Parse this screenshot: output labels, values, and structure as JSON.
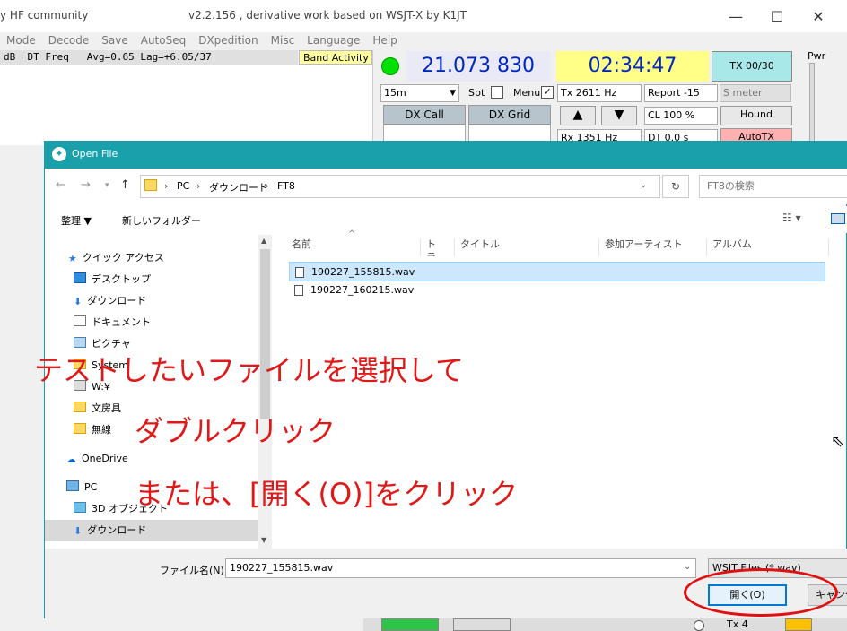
{
  "app": {
    "title": "y HF community",
    "version": "v2.2.156 , derivative work based on WSJT-X by K1JT",
    "window_controls": [
      "—",
      "☐",
      "✕"
    ]
  },
  "menu": [
    "Mode",
    "Decode",
    "Save",
    "AutoSeq",
    "DXpedition",
    "Misc",
    "Language",
    "Help"
  ],
  "decode_header": {
    "columns": "dB  DT Freq   Avg=0.65 Lag=+6.05/37",
    "band_activity": "Band Activity"
  },
  "radio": {
    "frequency": "21.073 830",
    "clock": "02:34:47",
    "tx_slot": "TX 00/30",
    "pwr": "Pwr",
    "band": "15m",
    "spt": "Spt",
    "menu": "Menu",
    "tx_freq": "Tx  2611  Hz",
    "report": "Report -15",
    "smeter": "S meter",
    "dx_call": "DX Call",
    "dx_grid": "DX Grid",
    "up_arrow": "▲",
    "down_arrow": "▼",
    "cl": "CL  100 %",
    "hound": "Hound",
    "rx_freq": "Rx  1351  Hz",
    "dt": "DT 0.0 s",
    "auto_tx": "AutoTX",
    "tx_bottom": "Tx 4"
  },
  "dialog": {
    "title": "Open File",
    "breadcrumb": [
      "PC",
      "ダウンロード",
      "FT8"
    ],
    "search_placeholder": "FT8の検索",
    "organize": "整理 ▼",
    "new_folder": "新しいフォルダー",
    "nav": {
      "quick_access": "クイック アクセス",
      "items": [
        "デスクトップ",
        "ダウンロード",
        "ドキュメント",
        "ピクチャ",
        "System",
        "W:¥",
        "文房具",
        "無線"
      ],
      "onedrive": "OneDrive",
      "pc": "PC",
      "pc_items": [
        "3D オブジェクト",
        "ダウンロード"
      ]
    },
    "columns": [
      "名前",
      "トラ...",
      "タイトル",
      "参加アーティスト",
      "アルバム"
    ],
    "files": [
      "190227_155815.wav",
      "190227_160215.wav"
    ],
    "filename_label": "ファイル名(N):",
    "filename_value": "190227_155815.wav",
    "filter": "WSJT Files (*.wav)",
    "open_button": "開く(O)",
    "cancel_button": "キャンセル"
  },
  "annotation": {
    "line1": "テストしたいファイルを選択して",
    "line2": "ダブルクリック",
    "line3": "または、[開く(O)]をクリック",
    "color": "#e01818"
  }
}
